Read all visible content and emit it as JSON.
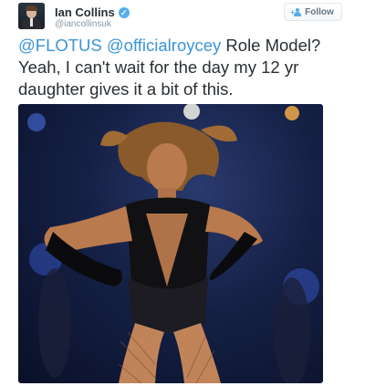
{
  "author": {
    "display_name": "Ian Collins",
    "handle": "@iancollinsuk",
    "verified_icon": "verified-badge-icon",
    "avatar_icon": "user-avatar"
  },
  "follow": {
    "label": "Follow",
    "icon": "add-user-icon"
  },
  "tweet": {
    "mention_1": "@FLOTUS",
    "mention_2": "@officialroycey",
    "text": " Role Model? Yeah, I can't wait for the day my 12 yr daughter gives it a bit of this."
  },
  "media": {
    "type": "photo",
    "subject": "performer on stage"
  },
  "colors": {
    "link": "#3b94d9",
    "text": "#292f33",
    "muted": "#8899a6",
    "verified": "#55acee"
  }
}
